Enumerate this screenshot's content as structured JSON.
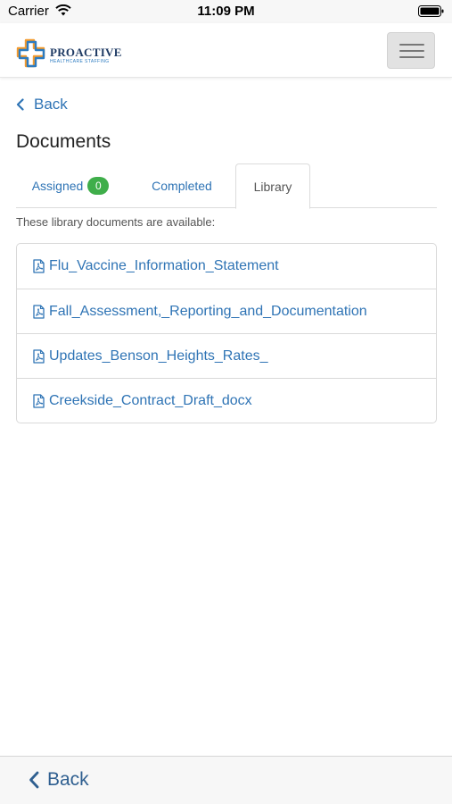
{
  "status_bar": {
    "carrier": "Carrier",
    "time": "11:09 PM"
  },
  "header": {
    "brand_name": "PROACTIVE",
    "brand_tagline": "HEALTHCARE STAFFING",
    "menu_icon": "hamburger-icon"
  },
  "nav": {
    "back_label": "Back"
  },
  "page": {
    "title": "Documents",
    "hint": "These library documents are available:"
  },
  "tabs": [
    {
      "label": "Assigned",
      "badge": "0",
      "active": false
    },
    {
      "label": "Completed",
      "active": false
    },
    {
      "label": "Library",
      "active": true
    }
  ],
  "documents": [
    {
      "name": "Flu_Vaccine_Information_Statement",
      "icon": "pdf-file-icon"
    },
    {
      "name": "Fall_Assessment,_Reporting_and_Documentation",
      "icon": "pdf-file-icon"
    },
    {
      "name": "Updates_Benson_Heights_Rates_",
      "icon": "pdf-file-icon"
    },
    {
      "name": "Creekside_Contract_Draft_docx",
      "icon": "pdf-file-icon"
    }
  ],
  "bottom_bar": {
    "back_label": "Back"
  },
  "colors": {
    "link": "#2f74b5",
    "badge": "#3fae4a",
    "brand_orange": "#f29a2e",
    "brand_blue": "#2c7bc0"
  }
}
